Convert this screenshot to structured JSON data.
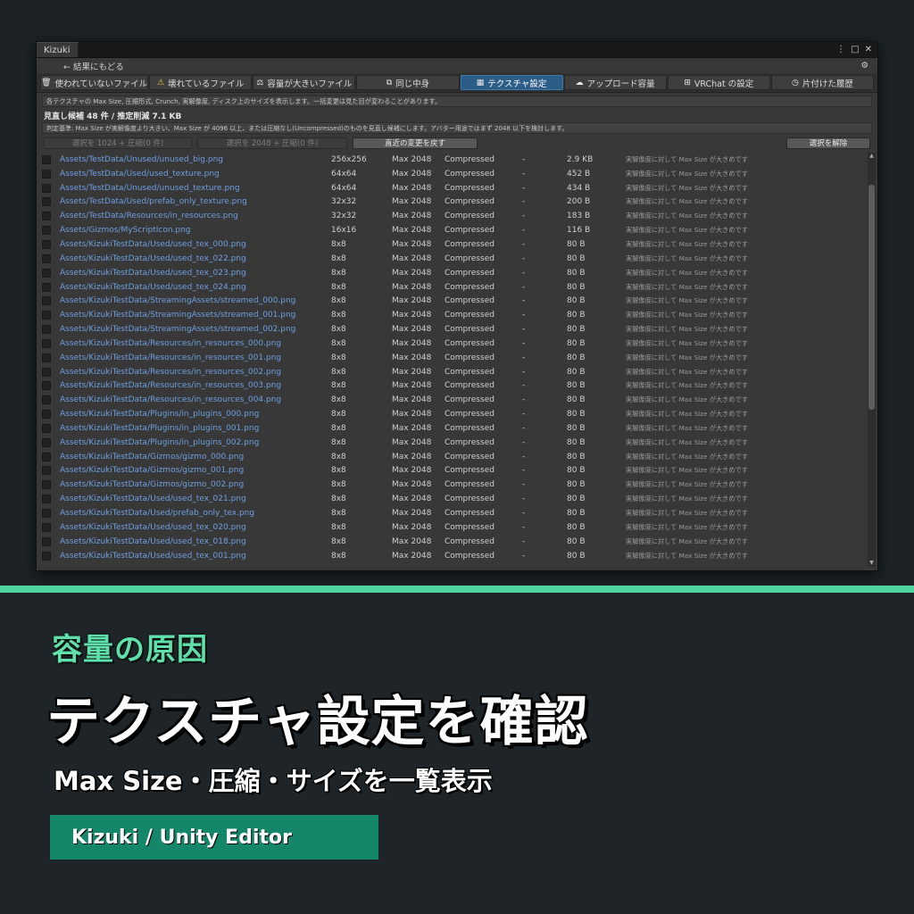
{
  "window": {
    "tab_title": "Kizuki",
    "back_label": "← 結果にもどる",
    "menu_icon": "kebab-menu-icon",
    "maximize_icon": "maximize-icon",
    "close_icon": "close-icon",
    "settings_icon": "gear-icon"
  },
  "tabs": [
    {
      "icon": "trash-icon",
      "glyph": "🗑",
      "label": "使われていないファイル",
      "active": false
    },
    {
      "icon": "warning-icon",
      "glyph": "⚠",
      "label": "壊れているファイル",
      "active": false
    },
    {
      "icon": "weight-icon",
      "glyph": "⚖",
      "label": "容量が大きいファイル",
      "active": false
    },
    {
      "icon": "duplicate-icon",
      "glyph": "⧉",
      "label": "同じ中身",
      "active": false
    },
    {
      "icon": "texture-icon",
      "glyph": "▦",
      "label": "テクスチャ設定",
      "active": true
    },
    {
      "icon": "cloud-icon",
      "glyph": "☁",
      "label": "アップロード容量",
      "active": false
    },
    {
      "icon": "windows-icon",
      "glyph": "⊞",
      "label": "VRChat の設定",
      "active": false
    },
    {
      "icon": "history-icon",
      "glyph": "◷",
      "label": "片付けた履歴",
      "active": false
    }
  ],
  "panel": {
    "info": "各テクスチャの Max Size, 圧縮形式, Crunch, 実解像度, ディスク上のサイズを表示します。一括変更は見た目が変わることがあります。",
    "summary": "見直し候補 48 件 / 推定削減 7.1 KB",
    "criteria": "判定基準: Max Size が実解像度より大きい、Max Size が 4096 以上、または圧縮なし(Uncompressed)のものを見直し候補にします。アバター用途ではまず 2048 以下を検討します。",
    "btn_1024": "選択を 1024 + 圧縮(0 件)",
    "btn_2048": "選択を 2048 + 圧縮(0 件)",
    "btn_revert": "直近の変更を戻す",
    "btn_deselect": "選択を解除"
  },
  "rows": [
    {
      "path": "Assets/TestData/Unused/unused_big.png",
      "dim": "256x256",
      "max": "Max 2048",
      "fmt": "Compressed",
      "crunch": "-",
      "size": "2.9 KB",
      "note": "実解像度に対して Max Size が大きめです"
    },
    {
      "path": "Assets/TestData/Used/used_texture.png",
      "dim": "64x64",
      "max": "Max 2048",
      "fmt": "Compressed",
      "crunch": "-",
      "size": "452 B",
      "note": "実解像度に対して Max Size が大きめです"
    },
    {
      "path": "Assets/TestData/Unused/unused_texture.png",
      "dim": "64x64",
      "max": "Max 2048",
      "fmt": "Compressed",
      "crunch": "-",
      "size": "434 B",
      "note": "実解像度に対して Max Size が大きめです"
    },
    {
      "path": "Assets/TestData/Used/prefab_only_texture.png",
      "dim": "32x32",
      "max": "Max 2048",
      "fmt": "Compressed",
      "crunch": "-",
      "size": "200 B",
      "note": "実解像度に対して Max Size が大きめです"
    },
    {
      "path": "Assets/TestData/Resources/in_resources.png",
      "dim": "32x32",
      "max": "Max 2048",
      "fmt": "Compressed",
      "crunch": "-",
      "size": "183 B",
      "note": "実解像度に対して Max Size が大きめです"
    },
    {
      "path": "Assets/Gizmos/MyScriptIcon.png",
      "dim": "16x16",
      "max": "Max 2048",
      "fmt": "Compressed",
      "crunch": "-",
      "size": "116 B",
      "note": "実解像度に対して Max Size が大きめです"
    },
    {
      "path": "Assets/KizukiTestData/Used/used_tex_000.png",
      "dim": "8x8",
      "max": "Max 2048",
      "fmt": "Compressed",
      "crunch": "-",
      "size": "80 B",
      "note": "実解像度に対して Max Size が大きめです"
    },
    {
      "path": "Assets/KizukiTestData/Used/used_tex_022.png",
      "dim": "8x8",
      "max": "Max 2048",
      "fmt": "Compressed",
      "crunch": "-",
      "size": "80 B",
      "note": "実解像度に対して Max Size が大きめです"
    },
    {
      "path": "Assets/KizukiTestData/Used/used_tex_023.png",
      "dim": "8x8",
      "max": "Max 2048",
      "fmt": "Compressed",
      "crunch": "-",
      "size": "80 B",
      "note": "実解像度に対して Max Size が大きめです"
    },
    {
      "path": "Assets/KizukiTestData/Used/used_tex_024.png",
      "dim": "8x8",
      "max": "Max 2048",
      "fmt": "Compressed",
      "crunch": "-",
      "size": "80 B",
      "note": "実解像度に対して Max Size が大きめです"
    },
    {
      "path": "Assets/KizukiTestData/StreamingAssets/streamed_000.png",
      "dim": "8x8",
      "max": "Max 2048",
      "fmt": "Compressed",
      "crunch": "-",
      "size": "80 B",
      "note": "実解像度に対して Max Size が大きめです"
    },
    {
      "path": "Assets/KizukiTestData/StreamingAssets/streamed_001.png",
      "dim": "8x8",
      "max": "Max 2048",
      "fmt": "Compressed",
      "crunch": "-",
      "size": "80 B",
      "note": "実解像度に対して Max Size が大きめです"
    },
    {
      "path": "Assets/KizukiTestData/StreamingAssets/streamed_002.png",
      "dim": "8x8",
      "max": "Max 2048",
      "fmt": "Compressed",
      "crunch": "-",
      "size": "80 B",
      "note": "実解像度に対して Max Size が大きめです"
    },
    {
      "path": "Assets/KizukiTestData/Resources/in_resources_000.png",
      "dim": "8x8",
      "max": "Max 2048",
      "fmt": "Compressed",
      "crunch": "-",
      "size": "80 B",
      "note": "実解像度に対して Max Size が大きめです"
    },
    {
      "path": "Assets/KizukiTestData/Resources/in_resources_001.png",
      "dim": "8x8",
      "max": "Max 2048",
      "fmt": "Compressed",
      "crunch": "-",
      "size": "80 B",
      "note": "実解像度に対して Max Size が大きめです"
    },
    {
      "path": "Assets/KizukiTestData/Resources/in_resources_002.png",
      "dim": "8x8",
      "max": "Max 2048",
      "fmt": "Compressed",
      "crunch": "-",
      "size": "80 B",
      "note": "実解像度に対して Max Size が大きめです"
    },
    {
      "path": "Assets/KizukiTestData/Resources/in_resources_003.png",
      "dim": "8x8",
      "max": "Max 2048",
      "fmt": "Compressed",
      "crunch": "-",
      "size": "80 B",
      "note": "実解像度に対して Max Size が大きめです"
    },
    {
      "path": "Assets/KizukiTestData/Resources/in_resources_004.png",
      "dim": "8x8",
      "max": "Max 2048",
      "fmt": "Compressed",
      "crunch": "-",
      "size": "80 B",
      "note": "実解像度に対して Max Size が大きめです"
    },
    {
      "path": "Assets/KizukiTestData/Plugins/in_plugins_000.png",
      "dim": "8x8",
      "max": "Max 2048",
      "fmt": "Compressed",
      "crunch": "-",
      "size": "80 B",
      "note": "実解像度に対して Max Size が大きめです"
    },
    {
      "path": "Assets/KizukiTestData/Plugins/in_plugins_001.png",
      "dim": "8x8",
      "max": "Max 2048",
      "fmt": "Compressed",
      "crunch": "-",
      "size": "80 B",
      "note": "実解像度に対して Max Size が大きめです"
    },
    {
      "path": "Assets/KizukiTestData/Plugins/in_plugins_002.png",
      "dim": "8x8",
      "max": "Max 2048",
      "fmt": "Compressed",
      "crunch": "-",
      "size": "80 B",
      "note": "実解像度に対して Max Size が大きめです"
    },
    {
      "path": "Assets/KizukiTestData/Gizmos/gizmo_000.png",
      "dim": "8x8",
      "max": "Max 2048",
      "fmt": "Compressed",
      "crunch": "-",
      "size": "80 B",
      "note": "実解像度に対して Max Size が大きめです"
    },
    {
      "path": "Assets/KizukiTestData/Gizmos/gizmo_001.png",
      "dim": "8x8",
      "max": "Max 2048",
      "fmt": "Compressed",
      "crunch": "-",
      "size": "80 B",
      "note": "実解像度に対して Max Size が大きめです"
    },
    {
      "path": "Assets/KizukiTestData/Gizmos/gizmo_002.png",
      "dim": "8x8",
      "max": "Max 2048",
      "fmt": "Compressed",
      "crunch": "-",
      "size": "80 B",
      "note": "実解像度に対して Max Size が大きめです"
    },
    {
      "path": "Assets/KizukiTestData/Used/used_tex_021.png",
      "dim": "8x8",
      "max": "Max 2048",
      "fmt": "Compressed",
      "crunch": "-",
      "size": "80 B",
      "note": "実解像度に対して Max Size が大きめです"
    },
    {
      "path": "Assets/KizukiTestData/Used/prefab_only_tex.png",
      "dim": "8x8",
      "max": "Max 2048",
      "fmt": "Compressed",
      "crunch": "-",
      "size": "80 B",
      "note": "実解像度に対して Max Size が大きめです"
    },
    {
      "path": "Assets/KizukiTestData/Used/used_tex_020.png",
      "dim": "8x8",
      "max": "Max 2048",
      "fmt": "Compressed",
      "crunch": "-",
      "size": "80 B",
      "note": "実解像度に対して Max Size が大きめです"
    },
    {
      "path": "Assets/KizukiTestData/Used/used_tex_018.png",
      "dim": "8x8",
      "max": "Max 2048",
      "fmt": "Compressed",
      "crunch": "-",
      "size": "80 B",
      "note": "実解像度に対して Max Size が大きめです"
    },
    {
      "path": "Assets/KizukiTestData/Used/used_tex_001.png",
      "dim": "8x8",
      "max": "Max 2048",
      "fmt": "Compressed",
      "crunch": "-",
      "size": "80 B",
      "note": "実解像度に対して Max Size が大きめです"
    }
  ],
  "promo": {
    "kicker": "容量の原因",
    "headline": "テクスチャ設定を確認",
    "subline": "Max Size・圧縮・サイズを一覧表示",
    "badge": "Kizuki / Unity Editor"
  },
  "colors": {
    "accent": "#4fd39f",
    "kicker": "#5fe0aa",
    "badge": "#14876a",
    "active_tab": "#2c5d87",
    "link": "#6f9ee0"
  }
}
